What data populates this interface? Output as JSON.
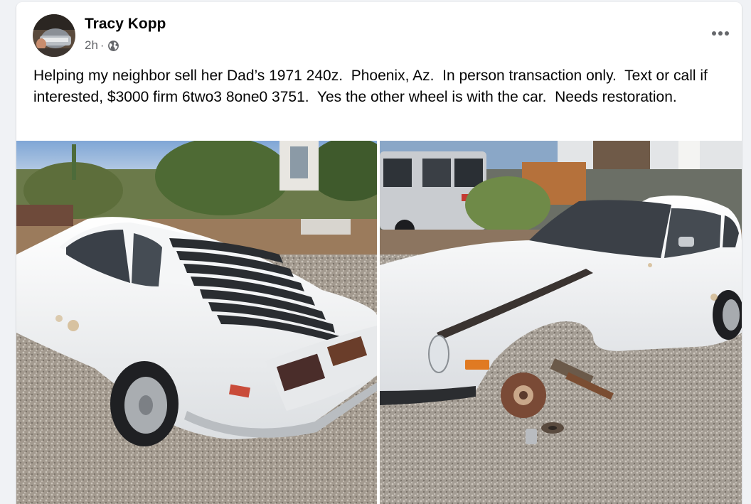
{
  "post": {
    "author_name": "Tracy Kopp",
    "timestamp": "2h",
    "separator": "·",
    "privacy_icon": "globe-icon",
    "more_icon": "more-horizontal-icon",
    "text": "Helping my neighbor sell her Dad’s 1971 240z.  Phoenix, Az.  In person transaction only.  Text or call if interested, $3000 firm 6two3 8one0 3751.  Yes the other wheel is with the car.  Needs restoration."
  },
  "photos": [
    {
      "subject": "White 1971 Datsun 240z, rear three-quarter view with window louvers"
    },
    {
      "subject": "White 1971 Datsun 240z, front three-quarter view with front wheel removed"
    }
  ],
  "colors": {
    "background": "#f0f2f5",
    "card": "#ffffff",
    "text_primary": "#050505",
    "text_secondary": "#65676b"
  }
}
